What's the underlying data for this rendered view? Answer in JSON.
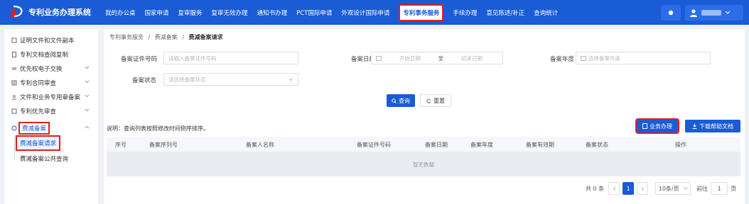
{
  "app": {
    "title": "专利业务办理系统"
  },
  "nav": [
    "我的办公桌",
    "国家申请",
    "复审服务",
    "复审无效办理",
    "通知书办理",
    "PCT国际申请",
    "外观设计国际申请",
    "专利事务服务",
    "手续办理",
    "意见陈述/补正",
    "查询统计"
  ],
  "nav_active_index": 7,
  "sidebar": {
    "items": [
      {
        "label": "证明文件和文件副本",
        "icon": "certificate-icon"
      },
      {
        "label": "专利文档查阅复制",
        "icon": "document-icon"
      },
      {
        "label": "优先权电子交换",
        "icon": "exchange-icon"
      },
      {
        "label": "专利合同审查",
        "icon": "contract-icon"
      },
      {
        "label": "文件和业务专用章备案",
        "icon": "stamp-icon"
      },
      {
        "label": "专利优先审查",
        "icon": "priority-icon"
      },
      {
        "label": "费减备案",
        "icon": "fee-icon"
      }
    ],
    "sub_items": [
      "费减备案请求",
      "费减备案公共查询"
    ]
  },
  "breadcrumb": {
    "root": "专利事务服务",
    "sep": "/",
    "parent": "费减备案",
    "current": "费减备案请求"
  },
  "search": {
    "cert_no_label": "备案证件号码",
    "cert_no_placeholder": "请输入备案证件号码",
    "date_label": "备案日期",
    "date_start_placeholder": "开始日期",
    "date_to": "至",
    "date_end_placeholder": "结束日期",
    "year_label": "备案年度",
    "year_placeholder": "选择备案年度",
    "status_label": "备案状态",
    "status_placeholder": "请选择备案状态",
    "query_button": "查询",
    "reset_button": "重置"
  },
  "note": "说明：查询列表按照修改时间倒序排序。",
  "actions": {
    "handle_button": "业务办理",
    "download_button": "下载帮助文档"
  },
  "table": {
    "columns": [
      "序号",
      "备案序列号",
      "备案人名称",
      "备案证件号码",
      "备案日期",
      "备案年度",
      "备案有效期",
      "备案状态",
      "操作"
    ],
    "empty_text": "暂无数据"
  },
  "pagination": {
    "total": "共 0 条",
    "current_page": "1",
    "page_size": "10条/页",
    "goto_label": "前往",
    "goto_value": "1",
    "page_suffix": "页"
  },
  "colors": {
    "primary": "#1a5bd6",
    "highlight": "#e0201c",
    "active_text": "#1a5bd6"
  }
}
